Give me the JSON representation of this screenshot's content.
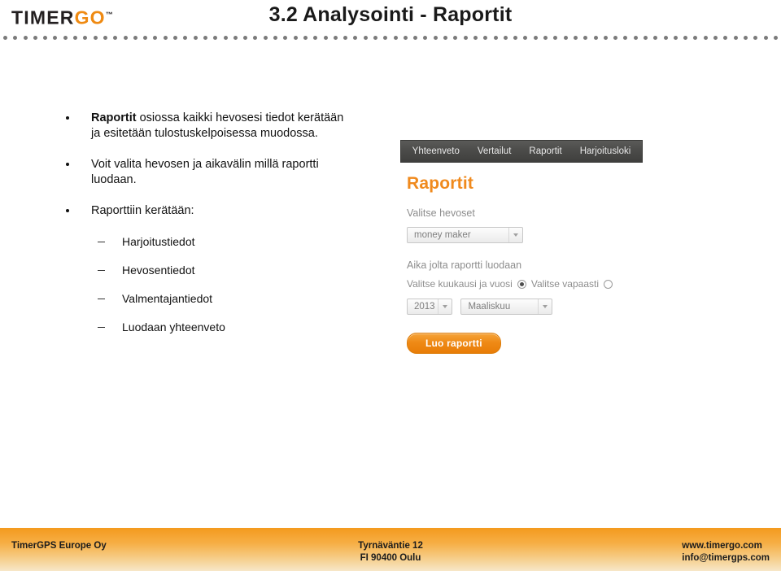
{
  "header": {
    "logo": {
      "part1": "TIMER",
      "part2": "GO",
      "tm": "™"
    },
    "title": "3.2 Analysointi - Raportit",
    "divider_dot_count": 78,
    "accent_color": "#ef8a12"
  },
  "content": {
    "bullets": [
      {
        "bold": "Raportit",
        "rest": " osiossa kaikki hevosesi tiedot kerätään ja esitetään tulostuskelpoisessa muodossa."
      },
      {
        "bold": "",
        "rest": "Voit valita hevosen ja aikavälin millä raportti luodaan."
      },
      {
        "bold": "",
        "rest": "Raporttiin kerätään:"
      }
    ],
    "sub_bullets": [
      "Harjoitustiedot",
      "Hevosentiedot",
      "Valmentajantiedot",
      "Luodaan yhteenveto"
    ]
  },
  "app": {
    "tabs": [
      {
        "label": "Yhteenveto"
      },
      {
        "label": "Vertailut"
      },
      {
        "label": "Raportit"
      },
      {
        "label": "Harjoitusloki"
      }
    ],
    "heading": "Raportit",
    "heading_color": "#f08a1d",
    "horse_label": "Valitse hevoset",
    "horse_value": "money maker",
    "time_label": "Aika jolta raportti luodaan",
    "radio_month_year_label": "Valitse kuukausi ja vuosi",
    "radio_free_label": "Valitse vapaasti",
    "radio_month_year_checked": true,
    "radio_free_checked": false,
    "year_value": "2013",
    "month_value": "Maaliskuu",
    "submit_label": "Luo raportti",
    "submit_color": "#ef8a16"
  },
  "footer": {
    "company": "TimerGPS Europe Oy",
    "address_line1": "Tyrnäväntie 12",
    "address_line2": "FI 90400 Oulu",
    "website": "www.timergo.com",
    "email": "info@timergps.com"
  }
}
